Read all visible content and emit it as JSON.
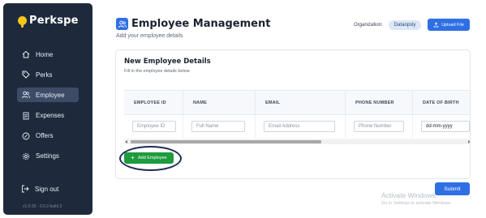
{
  "sidebar": {
    "brand": "Perkspe",
    "items": [
      {
        "label": "Home",
        "icon": "home-icon",
        "active": false
      },
      {
        "label": "Perks",
        "icon": "tag-icon",
        "active": false
      },
      {
        "label": "Employee",
        "icon": "users-icon",
        "active": true
      },
      {
        "label": "Expenses",
        "icon": "receipt-icon",
        "active": false
      },
      {
        "label": "Offers",
        "icon": "discount-icon",
        "active": false
      },
      {
        "label": "Settings",
        "icon": "gear-icon",
        "active": false
      }
    ],
    "signout_label": "Sign out",
    "version": "v1.0.33 - 0.0.2-build.2"
  },
  "header": {
    "title": "Employee Management",
    "subtitle": "Add your employee details",
    "org_label": "Organization:",
    "org_name": "Dataopsly",
    "upload_label": "Upload File"
  },
  "card": {
    "title": "New Employee Details",
    "subtitle": "Fill in the employee details below",
    "columns": [
      "EMPLOYEE ID",
      "NAME",
      "EMAIL",
      "PHONE NUMBER",
      "DATE OF BIRTH"
    ],
    "placeholders": [
      "Employee ID",
      "Full Name",
      "Email Address",
      "Phone Number",
      "dd-mm-yyyy"
    ],
    "add_label": "Add Employee"
  },
  "submit_label": "Submit",
  "watermark": {
    "title": "Activate Windows",
    "subtitle": "Go to Settings to activate Windows."
  },
  "colors": {
    "sidebar_bg": "#1e2a3c",
    "primary": "#2f6fe4",
    "success": "#1e9b3e",
    "brand_yellow": "#f5c518"
  }
}
